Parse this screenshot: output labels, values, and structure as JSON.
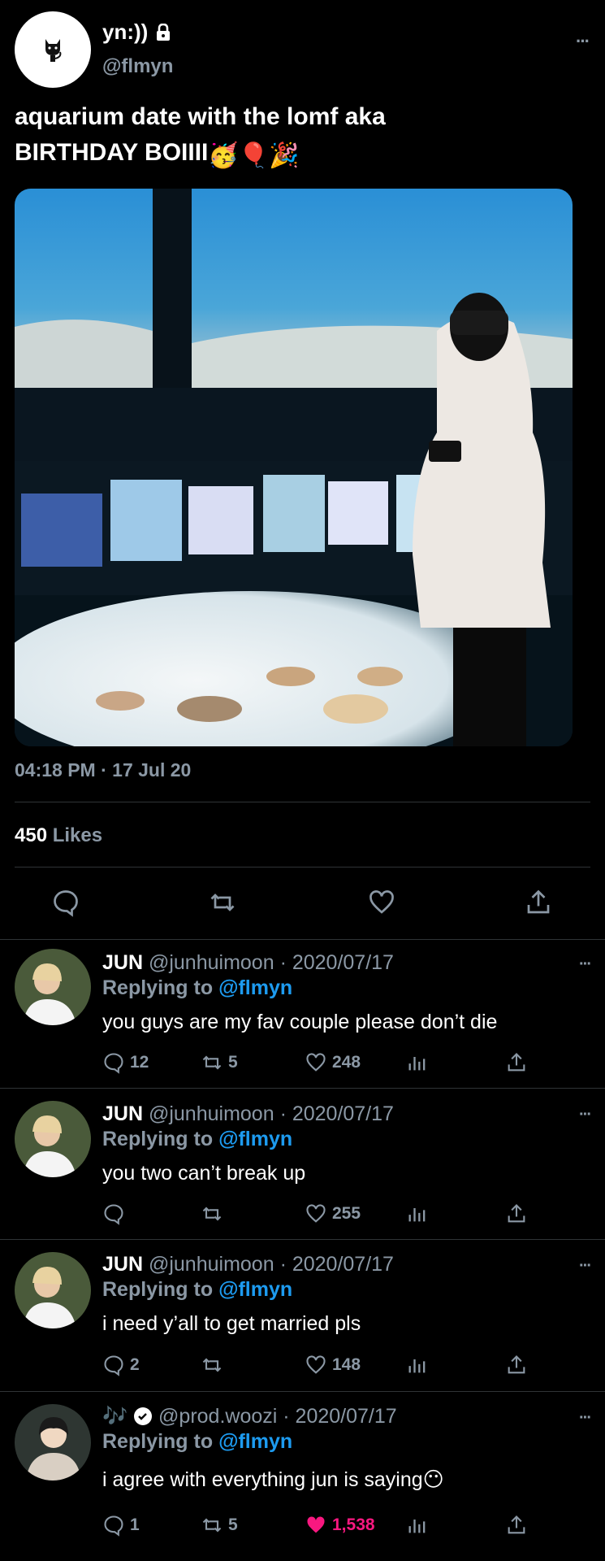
{
  "tweet": {
    "name": "yn:))",
    "handle": "@flmyn",
    "text_line1": "aquarium date with the lomf aka",
    "text_line2": "BIRTHDAY BOIIII",
    "emoji_line2": "🥳🎈🎉",
    "timestamp": "04:18 PM · 17 Jul 20",
    "likes_count": "450",
    "likes_label": "Likes",
    "more_label": "···"
  },
  "replies": [
    {
      "name": "JUN",
      "handle": "@junhuimoon",
      "date": "· 2020/07/17",
      "replying_prefix": "Replying to",
      "replying_to": "@flmyn",
      "text": "you guys are my fav couple please don’t die",
      "reply_count": "12",
      "retweet_count": "5",
      "like_count": "248",
      "liked": false
    },
    {
      "name": "JUN",
      "handle": "@junhuimoon",
      "date": "· 2020/07/17",
      "replying_prefix": "Replying to",
      "replying_to": "@flmyn",
      "text": "you two can’t break up",
      "reply_count": "",
      "retweet_count": "",
      "like_count": "255",
      "liked": false
    },
    {
      "name": "JUN",
      "handle": "@junhuimoon",
      "date": "· 2020/07/17",
      "replying_prefix": "Replying to",
      "replying_to": "@flmyn",
      "text": "i need y’all to get married pls",
      "reply_count": "2",
      "retweet_count": "",
      "like_count": "148",
      "liked": false
    },
    {
      "name": "🎶",
      "handle": "@prod.woozi",
      "date": "· 2020/07/17",
      "replying_prefix": "Replying to",
      "replying_to": "@flmyn",
      "text": "i agree with everything jun is saying😶",
      "reply_count": "1",
      "retweet_count": "5",
      "like_count": "1,538",
      "liked": true
    }
  ],
  "colors": {
    "background": "#000000",
    "muted": "#8b98a5",
    "link": "#1d9bf0",
    "like": "#f91880",
    "divider": "#2f3336"
  },
  "icons": [
    "lock-icon",
    "reply-icon",
    "retweet-icon",
    "like-icon",
    "share-icon",
    "analytics-icon",
    "more-icon",
    "verified-icon"
  ]
}
